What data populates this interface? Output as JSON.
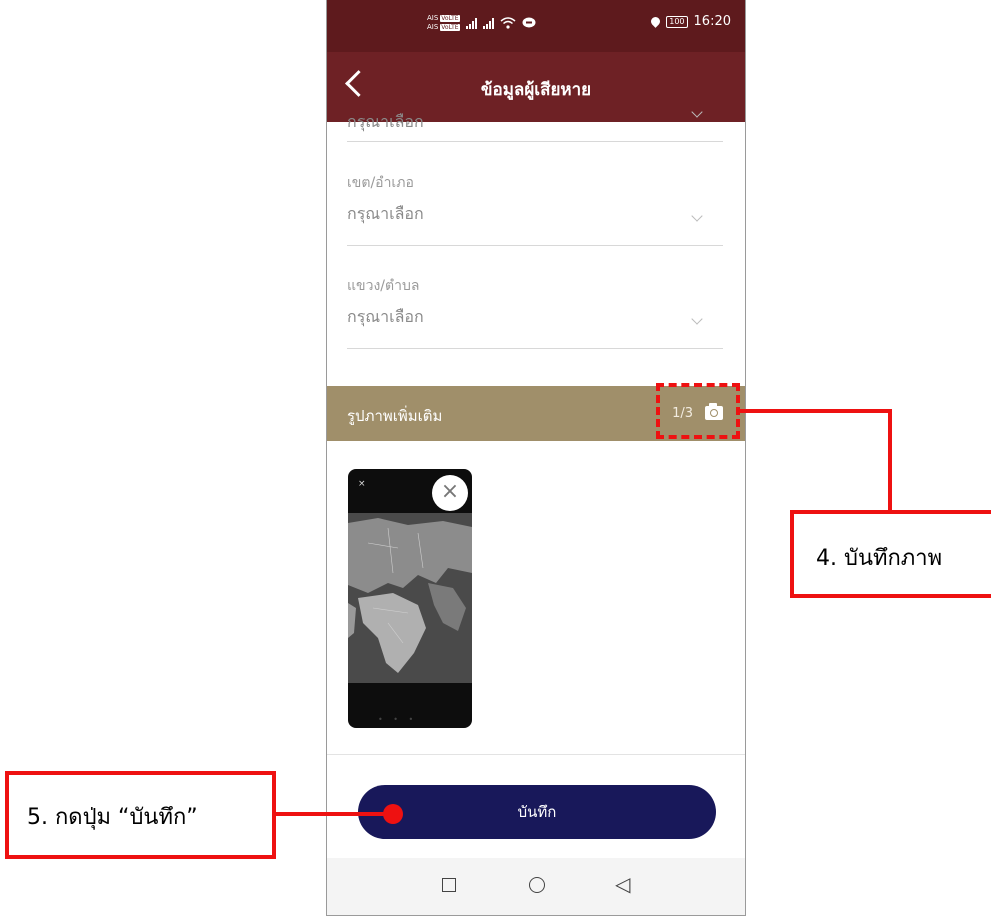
{
  "status_bar": {
    "carrier_1": "AIS",
    "carrier_2": "AIS",
    "volte": "VoLTE",
    "battery": "100",
    "time": "16:20"
  },
  "app_bar": {
    "title": "ข้อมูลผู้เสียหาย",
    "back_icon": "chevron-left-icon"
  },
  "form": {
    "partial_value": "กรุณาเลือก",
    "district": {
      "label": "เขต/อำเภอ",
      "value": "กรุณาเลือก"
    },
    "subdistrict": {
      "label": "แขวง/ตำบล",
      "value": "กรุณาเลือก"
    }
  },
  "photos": {
    "section_title": "รูปภาพเพิ่มเติม",
    "counter": "1/3",
    "camera_icon": "camera-icon",
    "thumbnail": {
      "close_symbol": "×",
      "corner_symbol": "×"
    }
  },
  "save_button": {
    "label": "บันทึก"
  },
  "nav_bar": {
    "icons": [
      "square-icon",
      "circle-icon",
      "triangle-back-icon"
    ]
  },
  "annotations": {
    "step4": "4. บันทึกภาพ",
    "step5": "5. กดปุ่ม “บันทึก”",
    "color": "#ee1111"
  }
}
